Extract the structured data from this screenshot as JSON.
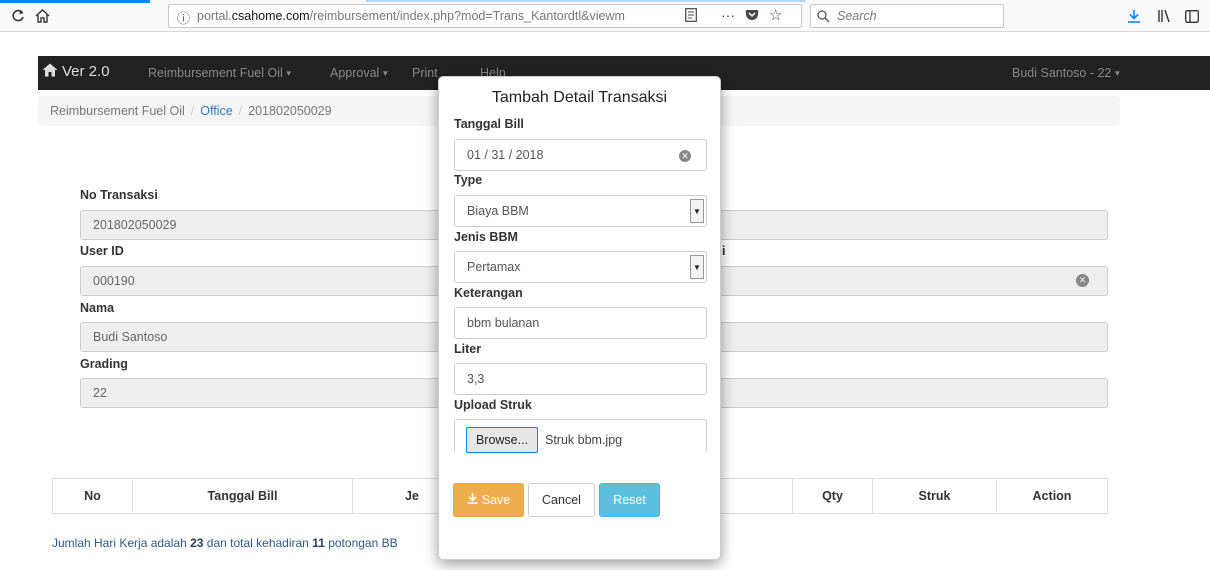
{
  "browser": {
    "url_prefix": "portal.",
    "url_domain": "csahome.com",
    "url_path": "/reimbursement/index.php?mod=Trans_Kantordtl&viewm",
    "search_placeholder": "Search"
  },
  "navbar": {
    "brand": "Ver 2.0",
    "items": [
      "Reimbursement Fuel Oil",
      "Approval",
      "Print",
      "Help"
    ],
    "user": "Budi Santoso - 22"
  },
  "breadcrumb": {
    "items": [
      "Reimbursement Fuel Oil",
      "Office",
      "201802050029"
    ]
  },
  "background_form": {
    "no_transaksi_label": "No Transaksi",
    "no_transaksi_value": "201802050029",
    "user_id_label": "User ID",
    "user_id_value": "000190",
    "nama_label": "Nama",
    "nama_value": "Budi Santoso",
    "grading_label": "Grading",
    "grading_value": "22",
    "partial_label": "i"
  },
  "table": {
    "headers": [
      "No",
      "Tanggal Bill",
      "Je",
      "Qty",
      "Struk",
      "Action"
    ]
  },
  "footer": {
    "prefix": "Jumlah Hari Kerja adalah ",
    "hari_kerja": "23",
    "middle": " dan total kehadiran ",
    "kehadiran": "11",
    "suffix": " potongan BB"
  },
  "modal": {
    "title": "Tambah Detail Transaksi",
    "tanggal_label": "Tanggal Bill",
    "tanggal_value": "01 / 31 / 2018",
    "type_label": "Type",
    "type_value": "Biaya BBM",
    "jenis_label": "Jenis BBM",
    "jenis_value": "Pertamax",
    "keterangan_label": "Keterangan",
    "keterangan_value": "bbm bulanan",
    "liter_label": "Liter",
    "liter_value": "3,3",
    "upload_label": "Upload Struk",
    "browse_label": "Browse...",
    "file_name": "Struk bbm.jpg",
    "save_label": "Save",
    "cancel_label": "Cancel",
    "reset_label": "Reset"
  },
  "colors": {
    "save": "#f0ad4e",
    "reset": "#5bc0de",
    "navbar": "#222222",
    "link": "#337ab7"
  }
}
